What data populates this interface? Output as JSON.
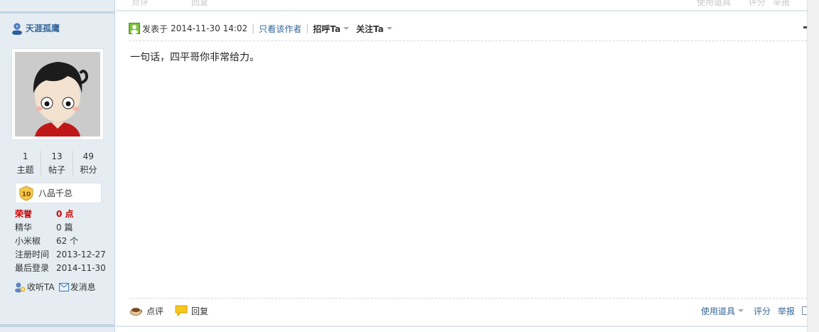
{
  "author": {
    "name": "天涯孤鹰",
    "stats": [
      {
        "value": "1",
        "label": "主题"
      },
      {
        "value": "13",
        "label": "帖子"
      },
      {
        "value": "49",
        "label": "积分"
      }
    ],
    "rank": {
      "level": "10",
      "name": "八品千总"
    },
    "info": [
      {
        "key": "荣誉",
        "value": "0 点"
      },
      {
        "key": "精华",
        "value": "0 篇"
      },
      {
        "key": "小米椒",
        "value": "62 个"
      },
      {
        "key": "注册时间",
        "value": "2013-12-27"
      },
      {
        "key": "最后登录",
        "value": "2014-11-30"
      }
    ],
    "actions": {
      "follow": "收听TA",
      "message": "发消息"
    }
  },
  "post": {
    "posted_label": "发表于",
    "posted_time": "2014-11-30 14:02",
    "only_author": "只看该作者",
    "greet": "招呼Ta",
    "follow": "关注Ta",
    "body": "一句话，四平哥你非常给力。",
    "footer": {
      "comment": "点评",
      "reply": "回复",
      "tools": "使用道具",
      "rate": "评分",
      "report": "举报"
    }
  },
  "prev_post_footer": {
    "comment": "点评",
    "reply": "回复",
    "tools": "使用道具",
    "rate": "评分",
    "report": "举报"
  },
  "colors": {
    "link": "#336699",
    "sidebar_bg": "#e5edf2",
    "honor": "#cc0000"
  }
}
